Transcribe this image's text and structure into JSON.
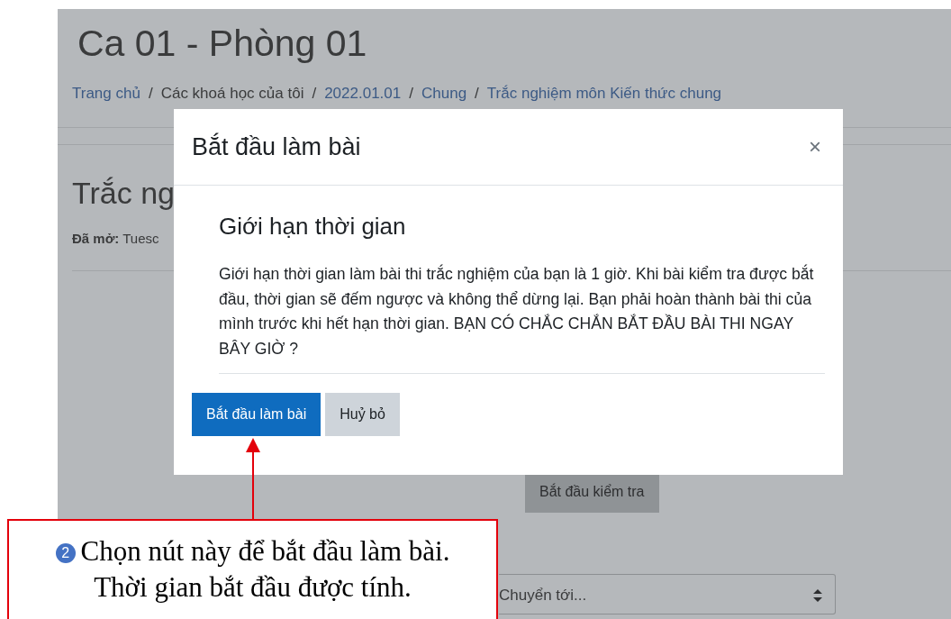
{
  "page": {
    "title": "Ca 01 - Phòng 01",
    "breadcrumb": {
      "separator": "/",
      "items": [
        {
          "label": "Trang chủ",
          "link": true
        },
        {
          "label": "Các khoá học của tôi",
          "link": false
        },
        {
          "label": "2022.01.01",
          "link": true
        },
        {
          "label": "Chung",
          "link": true
        },
        {
          "label": "Trắc nghiệm môn Kiến thức chung",
          "link": true
        }
      ]
    },
    "quiz_title": "Trắc ng",
    "opened": {
      "label": "Đã mở:",
      "value": "Tuesc"
    },
    "start_button": "Bắt đầu kiểm tra",
    "jump_select": {
      "placeholder": "Chuyển tới..."
    }
  },
  "modal": {
    "title": "Bắt đầu làm bài",
    "close": "×",
    "heading": "Giới hạn thời gian",
    "text": "Giới hạn thời gian làm bài thi trắc nghiệm của bạn là 1 giờ. Khi bài kiểm tra được bắt đầu, thời gian sẽ đếm ngược và không thể dừng lại. Bạn phải hoàn thành bài thi của mình trước khi hết hạn thời gian. BẠN CÓ CHẮC CHẮN BẮT ĐẦU BÀI THI NGAY BÂY GIỜ ?",
    "buttons": [
      {
        "label": "Bắt đầu làm bài",
        "kind": "primary"
      },
      {
        "label": "Huỷ bỏ",
        "kind": "secondary"
      }
    ]
  },
  "annotation": {
    "number": "2",
    "text": "Chọn nút này để bắt đầu làm bài.\nThời gian bắt đầu được tính."
  }
}
